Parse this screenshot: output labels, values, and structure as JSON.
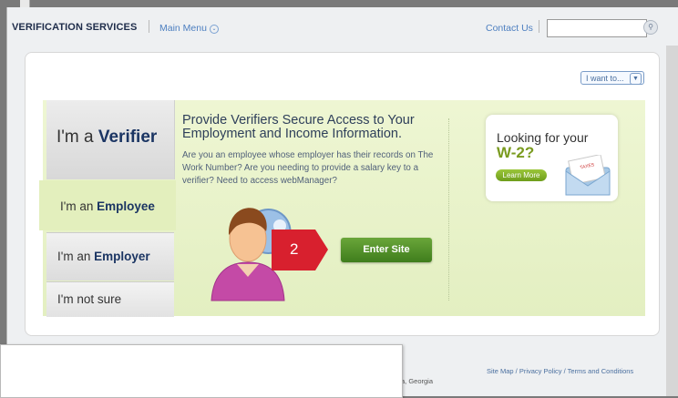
{
  "header": {
    "brand": "VERIFICATION SERVICES",
    "main_menu": "Main Menu",
    "contact": "Contact Us",
    "search_placeholder": ""
  },
  "i_want_to": "I want to...",
  "tabs": {
    "verifier_prefix": "I'm a ",
    "verifier_bold": "Verifier",
    "employee_prefix": "I'm an ",
    "employee_bold": "Employee",
    "employer_prefix": "I'm an ",
    "employer_bold": "Employer",
    "not_sure": "I'm not sure"
  },
  "content": {
    "headline": "Provide Verifiers Secure Access to Your Employment and Income Information.",
    "description": "Are you an employee whose employer has their records on The Work Number? Are you needing to provide a salary key to a verifier? Need to access webManager?",
    "enter_button": "Enter Site",
    "callout_number": "2"
  },
  "w2_card": {
    "line1": "Looking for your",
    "line2": "W-2?",
    "learn_more": "Learn More",
    "envelope_label": "TAXES"
  },
  "footer": {
    "links": "Site Map / Privacy Policy / Terms and Conditions",
    "partial_text": "a, Georgia"
  },
  "colors": {
    "brand_navy": "#1b3563",
    "link_blue": "#4d7fc0",
    "accent_green": "#5e9a2e",
    "callout_red": "#d8202e"
  }
}
